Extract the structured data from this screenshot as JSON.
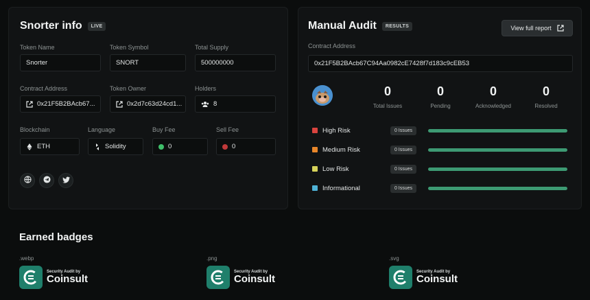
{
  "info": {
    "title": "Snorter info",
    "live_tag": "LIVE",
    "token_name_label": "Token Name",
    "token_name": "Snorter",
    "token_symbol_label": "Token Symbol",
    "token_symbol": "SNORT",
    "total_supply_label": "Total Supply",
    "total_supply": "500000000",
    "contract_address_label": "Contract Address",
    "contract_address": "0x21F5B2BAcb67...",
    "token_owner_label": "Token Owner",
    "token_owner": "0x2d7c63d24cd1...",
    "holders_label": "Holders",
    "holders": "8",
    "blockchain_label": "Blockchain",
    "blockchain": "ETH",
    "language_label": "Language",
    "language": "Solidity",
    "buy_fee_label": "Buy Fee",
    "buy_fee": "0",
    "sell_fee_label": "Sell Fee",
    "sell_fee": "0",
    "social_icons": [
      "globe-icon",
      "telegram-icon",
      "twitter-icon"
    ]
  },
  "audit": {
    "title": "Manual Audit",
    "results_tag": "RESULTS",
    "view_report_label": "View full report",
    "contract_address_label": "Contract Address",
    "contract_address": "0x21F5B2BAcb67C94Aa0982cE7428f7d183c9cEB53",
    "stats": [
      {
        "value": "0",
        "label": "Total Issues"
      },
      {
        "value": "0",
        "label": "Pending"
      },
      {
        "value": "0",
        "label": "Acknowledged"
      },
      {
        "value": "0",
        "label": "Resolved"
      }
    ],
    "risks": [
      {
        "name": "High Risk",
        "badge": "0 Issues",
        "color": "#d9443f"
      },
      {
        "name": "Medium Risk",
        "badge": "0 Issues",
        "color": "#e8862a"
      },
      {
        "name": "Low Risk",
        "badge": "0 Issues",
        "color": "#d6d25a"
      },
      {
        "name": "Informational",
        "badge": "0 Issues",
        "color": "#4fb2d6"
      }
    ],
    "bar_color": "#3d9a73"
  },
  "badges": {
    "title": "Earned badges",
    "items": [
      {
        "format": ".webp",
        "small": "Security Audit by",
        "big": "Coinsult"
      },
      {
        "format": ".png",
        "small": "Security Audit by",
        "big": "Coinsult"
      },
      {
        "format": ".svg",
        "small": "Security Audit by",
        "big": "Coinsult"
      }
    ]
  },
  "colors": {
    "green_dot": "#3fbf6a",
    "red_dot": "#c0393a",
    "badge_teal": "#1f7f6b"
  }
}
